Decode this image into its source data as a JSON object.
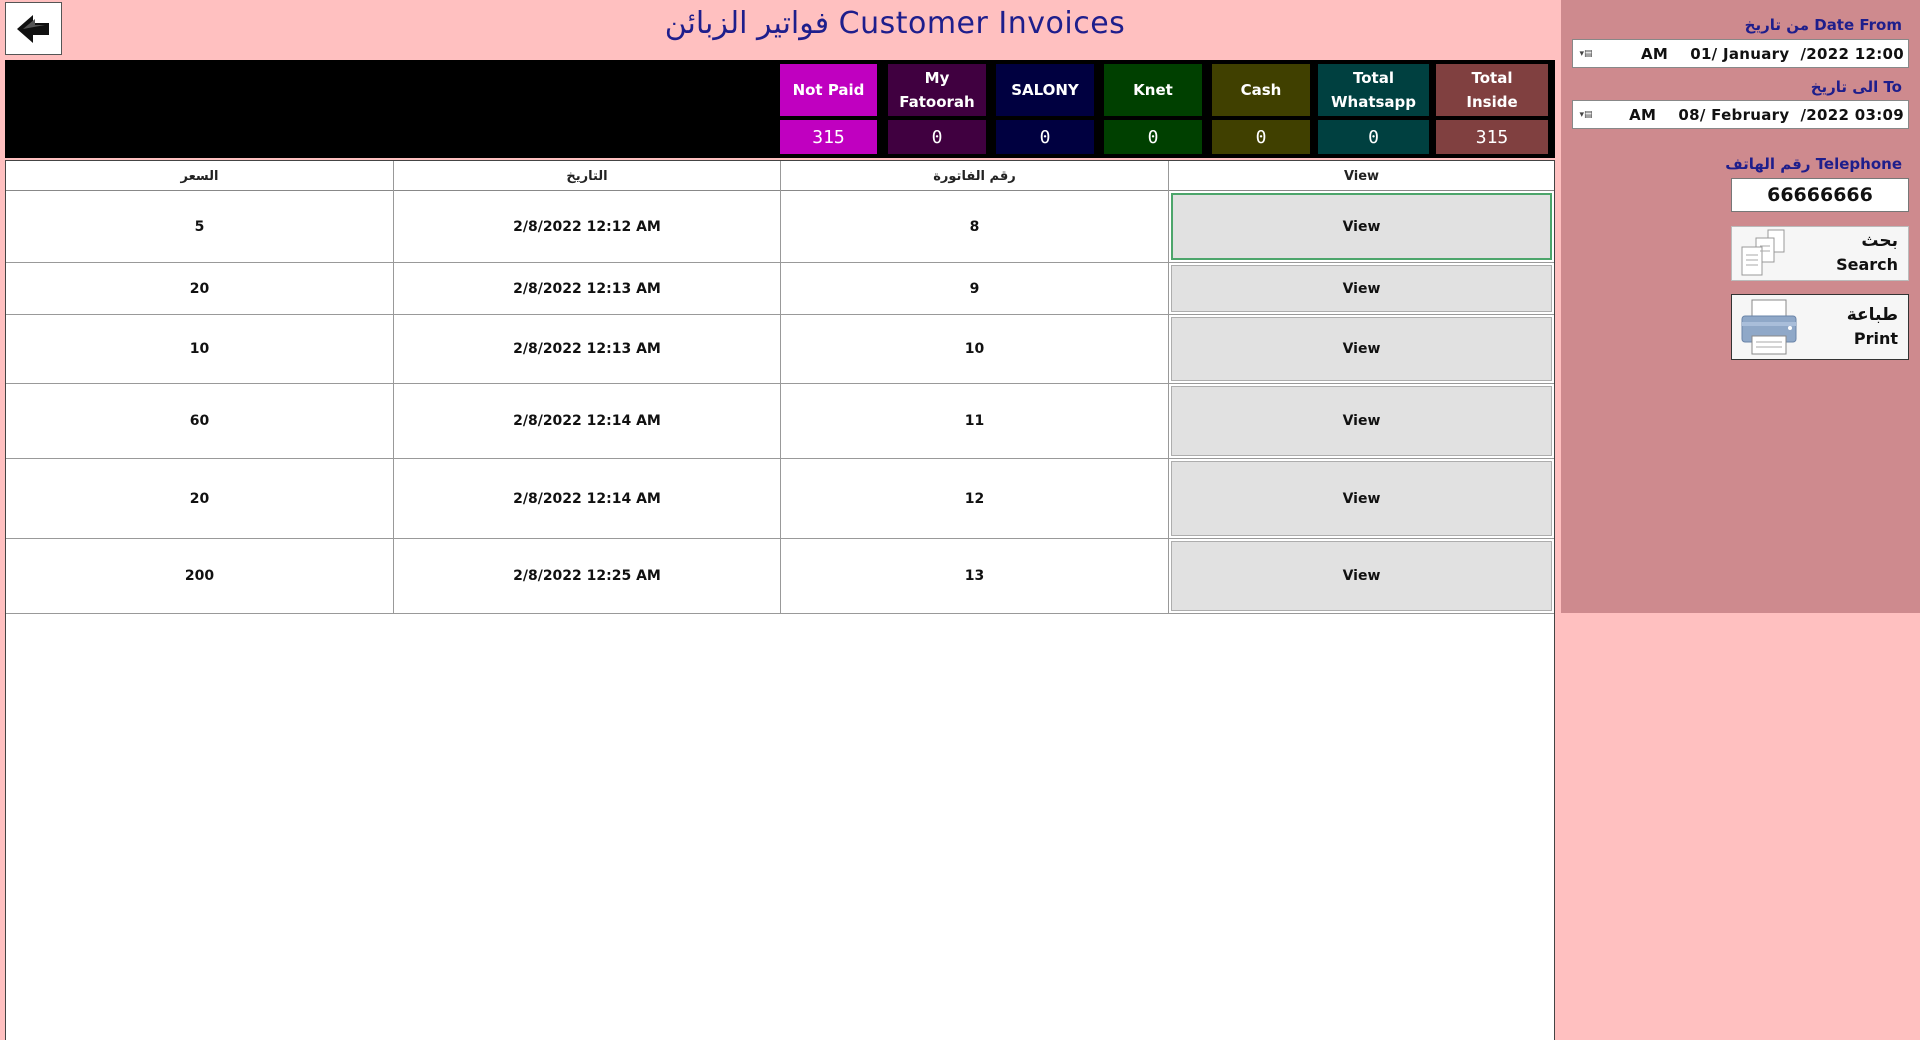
{
  "page": {
    "title": "فواتير الزبائن Customer Invoices"
  },
  "totals": [
    {
      "label": "Not Paid",
      "value": "315",
      "color": "#C000C0"
    },
    {
      "label": "My\nFatoorah",
      "value": "0",
      "color": "#400040"
    },
    {
      "label": "SALONY",
      "value": "0",
      "color": "#000040"
    },
    {
      "label": "Knet",
      "value": "0",
      "color": "#004000"
    },
    {
      "label": "Cash",
      "value": "0",
      "color": "#404000"
    },
    {
      "label": "Total\nWhatsapp",
      "value": "0",
      "color": "#004040"
    },
    {
      "label": "Total\nInside",
      "value": "315",
      "color": "#804040"
    }
  ],
  "table": {
    "columns": {
      "price": "السعر",
      "date": "التاريخ",
      "invoice_no": "رقم الفاتورة",
      "view": "View"
    },
    "rows": [
      {
        "price": "5",
        "date": "2/8/2022 12:12 AM",
        "invoice_no": "8",
        "view": "View"
      },
      {
        "price": "20",
        "date": "2/8/2022 12:13 AM",
        "invoice_no": "9",
        "view": "View"
      },
      {
        "price": "10",
        "date": "2/8/2022 12:13 AM",
        "invoice_no": "10",
        "view": "View"
      },
      {
        "price": "60",
        "date": "2/8/2022 12:14 AM",
        "invoice_no": "11",
        "view": "View"
      },
      {
        "price": "20",
        "date": "2/8/2022 12:14 AM",
        "invoice_no": "12",
        "view": "View"
      },
      {
        "price": "200",
        "date": "2/8/2022 12:25 AM",
        "invoice_no": "13",
        "view": "View"
      }
    ]
  },
  "sidebar": {
    "date_from_label": "من تاريخ Date From",
    "date_from_value": "12:00 AM    01/ January  /2022",
    "date_to_label": "الى تاريخ To",
    "date_to_value": "03:09 AM    08/ February  /2022",
    "phone_label": "رقم الهاتف Telephone",
    "phone_value": "66666666",
    "search_ar": "بحث",
    "search_en": "Search",
    "print_ar": "طباعة",
    "print_en": "Print"
  }
}
